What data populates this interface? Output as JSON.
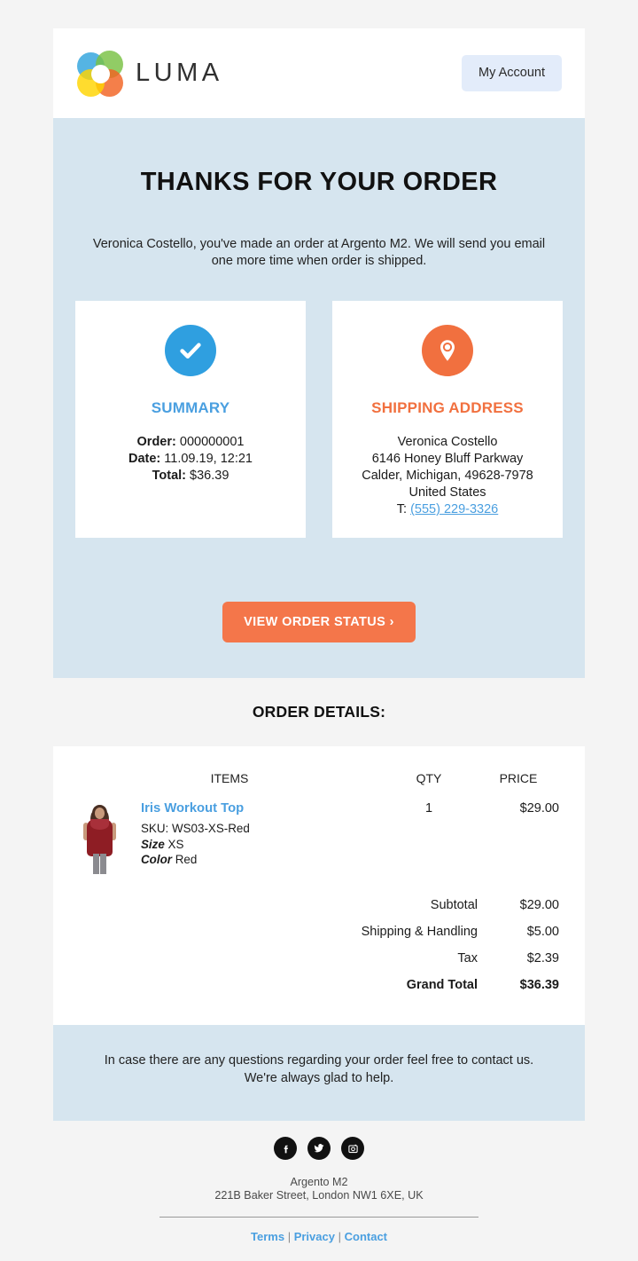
{
  "header": {
    "brand": "LUMA",
    "account_button": "My Account"
  },
  "hero": {
    "title": "THANKS FOR YOUR ORDER",
    "subtitle": "Veronica Costello, you've made an order at Argento M2. We will send you email one more time when order is shipped."
  },
  "summary_card": {
    "heading": "SUMMARY",
    "order_label": "Order:",
    "order_value": "000000001",
    "date_label": "Date:",
    "date_value": "11.09.19, 12:21",
    "total_label": "Total:",
    "total_value": "$36.39"
  },
  "shipping_card": {
    "heading": "SHIPPING ADDRESS",
    "name": "Veronica Costello",
    "street": "6146 Honey Bluff Parkway",
    "city_state_zip": "Calder, Michigan, 49628-7978",
    "country": "United States",
    "phone_label": "T:",
    "phone": "(555) 229-3326"
  },
  "cta": {
    "label": "VIEW ORDER STATUS ›"
  },
  "order_details": {
    "title": "ORDER DETAILS:",
    "columns": {
      "items": "ITEMS",
      "qty": "QTY",
      "price": "PRICE"
    },
    "items": [
      {
        "name": "Iris Workout Top",
        "sku_line": "SKU: WS03-XS-Red",
        "size_label": "Size",
        "size_value": "XS",
        "color_label": "Color",
        "color_value": "Red",
        "qty": "1",
        "price": "$29.00"
      }
    ],
    "totals": [
      {
        "label": "Subtotal",
        "value": "$29.00",
        "bold": false
      },
      {
        "label": "Shipping & Handling",
        "value": "$5.00",
        "bold": false
      },
      {
        "label": "Tax",
        "value": "$2.39",
        "bold": false
      },
      {
        "label": "Grand Total",
        "value": "$36.39",
        "bold": true
      }
    ]
  },
  "help": {
    "text": "In case there are any questions regarding your order feel free to contact us. We're always glad to help."
  },
  "footer": {
    "social": [
      "facebook-icon",
      "twitter-icon",
      "instagram-icon"
    ],
    "company": "Argento M2",
    "address": "221B Baker Street, London NW1 6XE, UK",
    "links": [
      "Terms",
      "Privacy",
      "Contact"
    ],
    "separator": "|"
  },
  "colors": {
    "banner_blue": "#d6e5ef",
    "accent_orange": "#f4764a",
    "accent_blue": "#4a9fe0",
    "page_gray": "#f4f4f4"
  }
}
